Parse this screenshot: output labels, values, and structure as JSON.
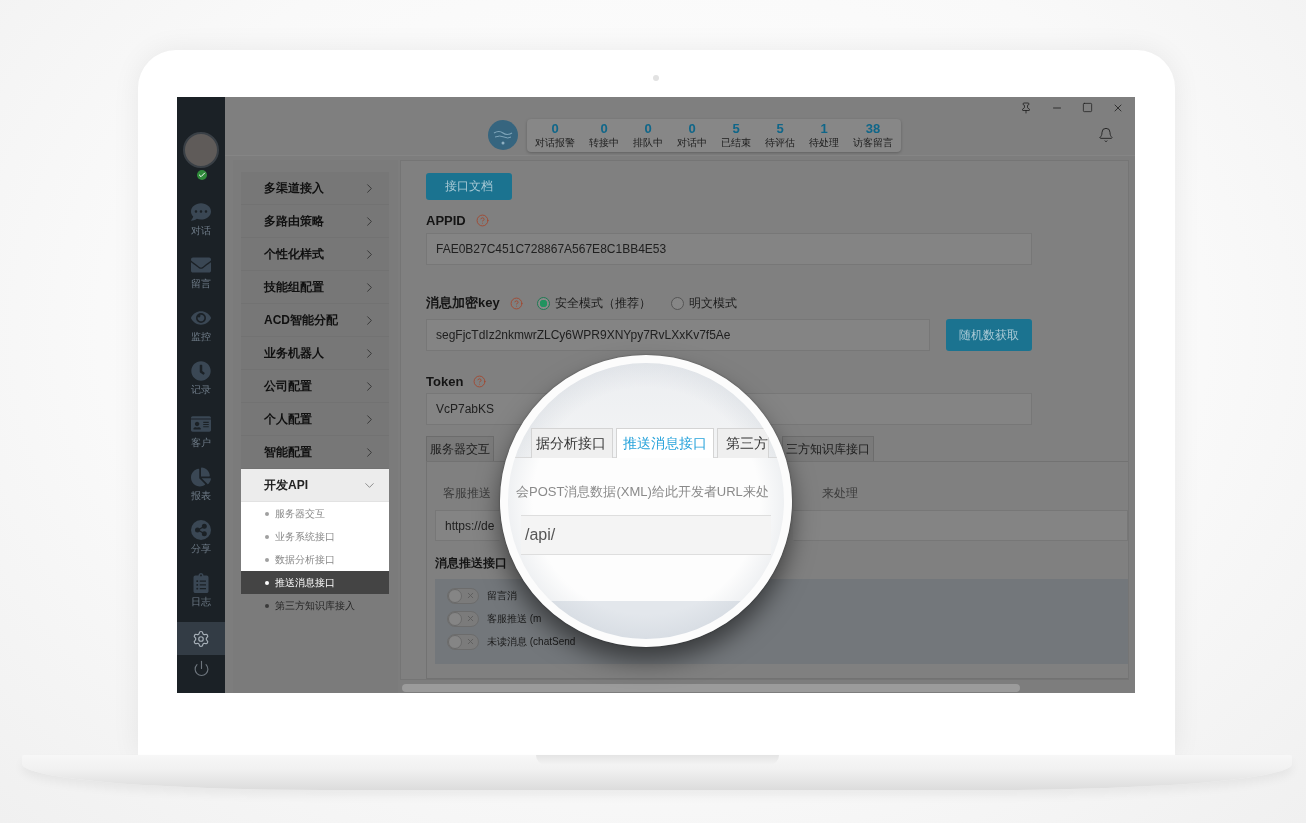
{
  "user": {
    "online": true
  },
  "nav_items": [
    {
      "label": "对话",
      "selected": false
    },
    {
      "label": "留言",
      "selected": false
    },
    {
      "label": "监控",
      "selected": false
    },
    {
      "label": "记录",
      "selected": false
    },
    {
      "label": "客户",
      "selected": false
    },
    {
      "label": "报表",
      "selected": false
    },
    {
      "label": "分享",
      "selected": false
    },
    {
      "label": "日志",
      "selected": false
    }
  ],
  "settings_item": {
    "selected": true
  },
  "stats": [
    {
      "value": "0",
      "label": "对话报警"
    },
    {
      "value": "0",
      "label": "转接中"
    },
    {
      "value": "0",
      "label": "排队中"
    },
    {
      "value": "0",
      "label": "对话中"
    },
    {
      "value": "5",
      "label": "已结束"
    },
    {
      "value": "5",
      "label": "待评估"
    },
    {
      "value": "1",
      "label": "待处理"
    },
    {
      "value": "38",
      "label": "访客留言"
    }
  ],
  "menu": [
    {
      "label": "多渠道接入",
      "expanded": false,
      "highlighted": false
    },
    {
      "label": "多路由策略",
      "expanded": false,
      "highlighted": false
    },
    {
      "label": "个性化样式",
      "expanded": false,
      "highlighted": false
    },
    {
      "label": "技能组配置",
      "expanded": false,
      "highlighted": false
    },
    {
      "label": "ACD智能分配",
      "expanded": false,
      "highlighted": false
    },
    {
      "label": "业务机器人",
      "expanded": false,
      "highlighted": false
    },
    {
      "label": "公司配置",
      "expanded": false,
      "highlighted": false
    },
    {
      "label": "个人配置",
      "expanded": false,
      "highlighted": false
    },
    {
      "label": "智能配置",
      "expanded": false,
      "highlighted": false
    },
    {
      "label": "开发API",
      "expanded": true,
      "highlighted": true,
      "children": [
        {
          "label": "服务器交互",
          "selected": false,
          "highlighted": true
        },
        {
          "label": "业务系统接口",
          "selected": false,
          "highlighted": true
        },
        {
          "label": "数据分析接口",
          "selected": false,
          "highlighted": true
        },
        {
          "label": "推送消息接口",
          "selected": true,
          "highlighted": true
        },
        {
          "label": "第三方知识库接入",
          "selected": false,
          "highlighted": false
        }
      ]
    }
  ],
  "docs_button": "接口文档",
  "appid": {
    "label": "APPID",
    "value": "FAE0B27C451C728867A567E8C1BB4E53"
  },
  "encryption_key": {
    "label": "消息加密key",
    "modes": [
      {
        "label": "安全模式（推荐）",
        "selected": true
      },
      {
        "label": "明文模式",
        "selected": false
      }
    ],
    "value": "segFjcTdIz2nkmwrZLCy6WPR9XNYpy7RvLXxKv7f5Ae",
    "button": "随机数获取"
  },
  "token": {
    "label": "Token",
    "value": "VcP7abKS"
  },
  "tabs": [
    {
      "label": "服务器交互",
      "selected": false
    },
    {
      "label": "三方知识库接口",
      "selected": false
    }
  ],
  "push_panel": {
    "description_start": "客服推送",
    "description_end": "来处理",
    "url_value": "https://de",
    "section_label": "消息推送接口",
    "switches": [
      {
        "label": "留言消",
        "on": false
      },
      {
        "label": "客服推送 (m",
        "on": false
      },
      {
        "label": "未读消息 (chatSend",
        "on": false
      }
    ]
  },
  "magnifier": {
    "tabs": [
      {
        "label": "据分析接口",
        "selected": false
      },
      {
        "label": "推送消息接口",
        "selected": true
      },
      {
        "label": "第三方",
        "selected": false
      }
    ],
    "description": "会POST消息数据(XML)给此开发者URL来处",
    "url_value": "/api/"
  }
}
